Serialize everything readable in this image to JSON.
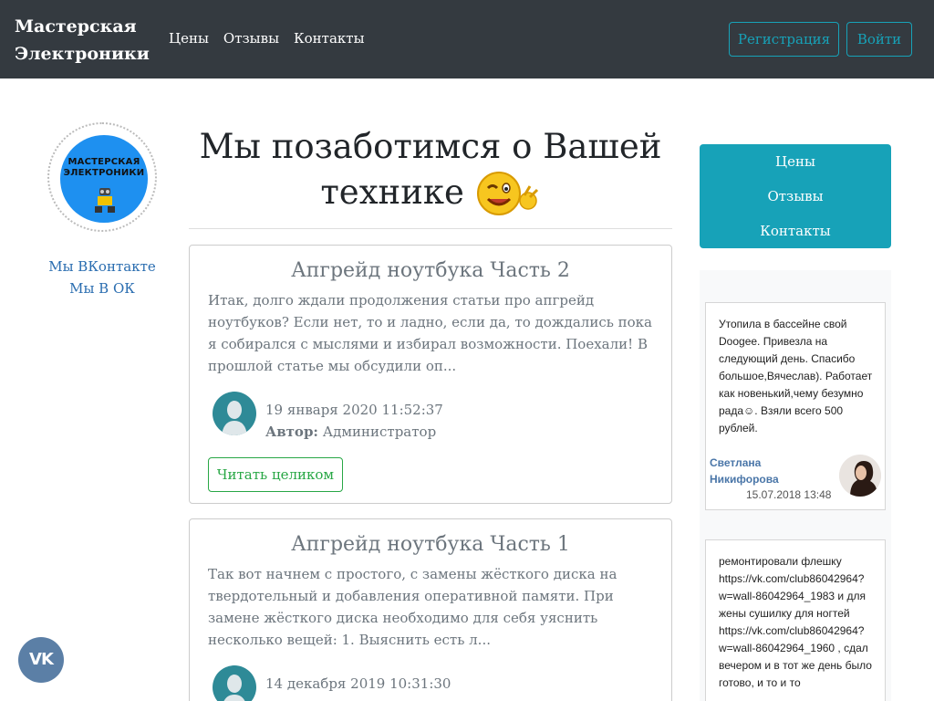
{
  "brand": {
    "line1": "Мастерская",
    "line2": "Электроники"
  },
  "nav": {
    "links": [
      "Цены",
      "Отзывы",
      "Контакты"
    ],
    "register_label": "Регистрация",
    "login_label": "Войти"
  },
  "left": {
    "logo": {
      "text_line1": "МАСТЕРСКАЯ",
      "text_line2": "ЭЛЕКТРОНИКИ"
    },
    "links": [
      "Мы ВКонтакте",
      "Мы В ОК"
    ]
  },
  "main": {
    "title_line1": "Мы позаботимся о Вашей",
    "title_line2": "технике",
    "posts": [
      {
        "title": "Апгрейд ноутбука Часть 2",
        "excerpt": "Итак, долго ждали продолжения статьи про апгрейд ноутбуков? Если нет, то и ладно, если да, то дождались пока я собирался с мыслями и избирал возможности. Поехали! В прошлой статье мы обсудили оп...",
        "date": "19 января 2020 11:52:37",
        "author_label": "Автор:",
        "author": "Администратор",
        "read_label": "Читать целиком"
      },
      {
        "title": "Апгрейд ноутбука Часть 1",
        "excerpt": "Так вот начнем с простого, с замены жёсткого диска на твердотельный и добавления оперативной памяти. При замене жёсткого диска необходимо для себя уяснить несколько вещей: 1. Выяснить есть л...",
        "date": "14 декабря 2019 10:31:30"
      }
    ]
  },
  "right": {
    "menu": [
      "Цены",
      "Отзывы",
      "Контакты"
    ],
    "reviews": [
      {
        "text": "Утопила в бассейне свой Doogee. Привезла на следующий день. Спасибо большое,Вячеслав). Работает как новенький,чему безумно рада☺. Взяли всего 500 рублей.",
        "author": "Светлана Никифорова",
        "date": "15.07.2018 13:48"
      },
      {
        "text": "ремонтировали флешку https://vk.com/club86042964?w=wall-86042964_1983 и для жены сушилку для ногтей https://vk.com/club86042964?w=wall-86042964_1960 , сдал вечером и в тот же день было готово, и то и то"
      }
    ]
  },
  "vk_fab": "VK",
  "colors": {
    "navbar": "#343a40",
    "accent": "#17a2b8",
    "success": "#28a745",
    "link": "#2a6db0"
  }
}
